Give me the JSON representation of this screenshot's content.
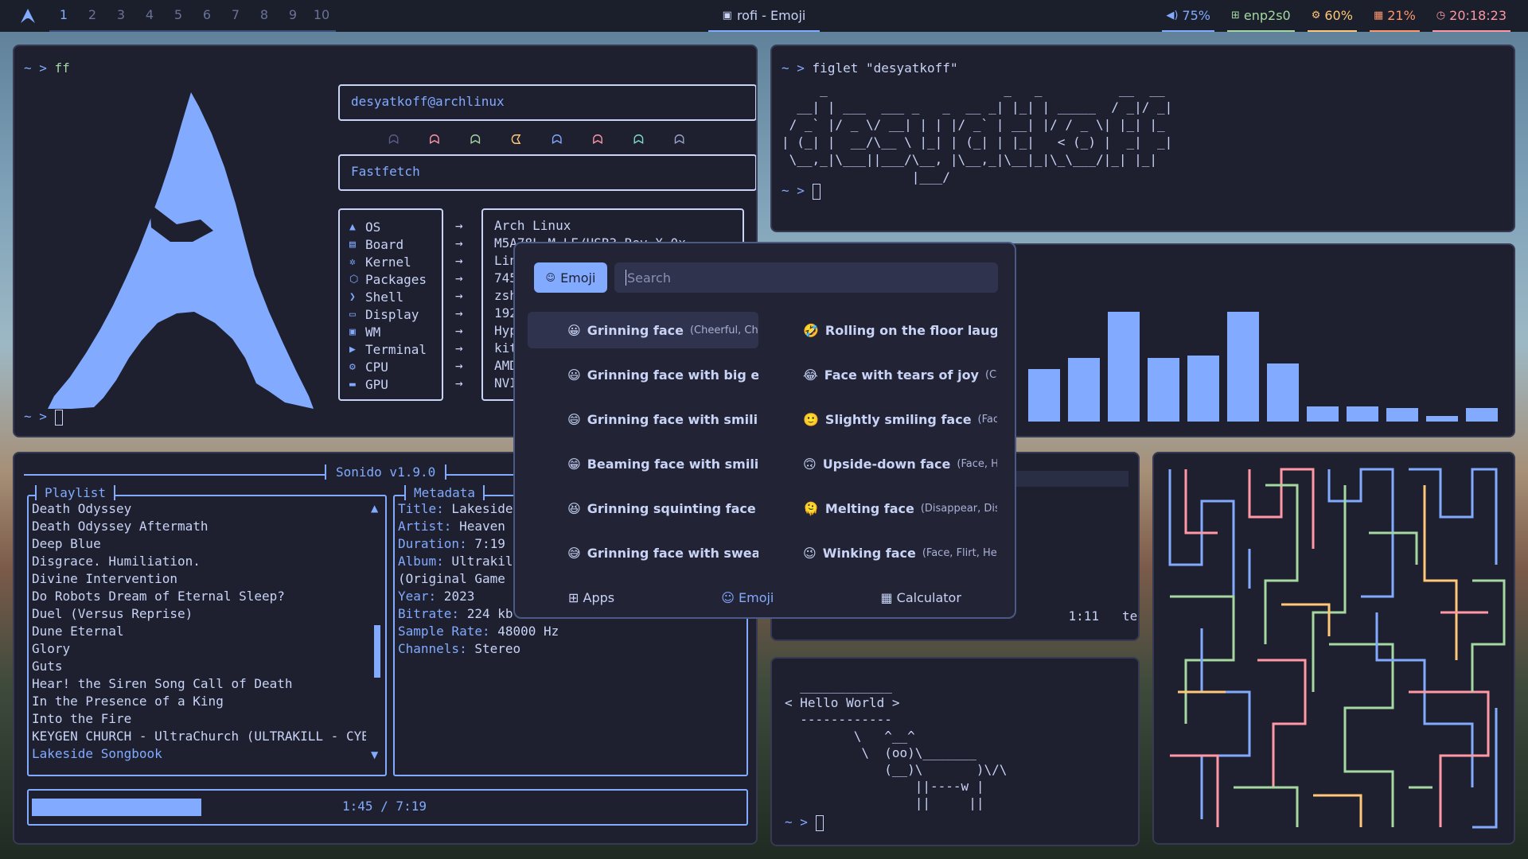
{
  "topbar": {
    "workspaces": [
      "1",
      "2",
      "3",
      "4",
      "5",
      "6",
      "7",
      "8",
      "9",
      "10"
    ],
    "active_workspace": "1",
    "window_title": "rofi - Emoji",
    "volume": "75%",
    "network": "enp2s0",
    "cpu": "60%",
    "memory": "21%",
    "clock": "20:18:23"
  },
  "fastfetch_term": {
    "prompt": "~ >",
    "command": "ff",
    "user_host": "desyatkoff@archlinux",
    "title": "Fastfetch",
    "keys": [
      "OS",
      "Board",
      "Kernel",
      "Packages",
      "Shell",
      "Display",
      "WM",
      "Terminal",
      "CPU",
      "GPU"
    ],
    "values": [
      "Arch Linux",
      "M5A78L-M LE/USB3 Rev X.0x",
      "Lin",
      "745",
      "zsh",
      "192",
      "Hyp",
      "kit",
      "AMD",
      "NVI"
    ],
    "ghost_colors": [
      "#565f89",
      "#ff98a4",
      "#a5d8a0",
      "#ffc777",
      "#82aaff",
      "#ff98a4",
      "#7fdbca",
      "#9aa5ce"
    ]
  },
  "figlet_term": {
    "prompt": "~ >",
    "command": "figlet \"desyatkoff\"",
    "art": "     _                       _   _          __  __ \n  __| | ___  ___ _   _  __ _| |_| | _____  / _|/ _|\n / _` |/ _ \\/ __| | | |/ _` | __| |/ / _ \\| |_| |_ \n| (_| |  __/\\__ \\ |_| | (_| | |_|   < (_) |  _|  _|\n \\__,_|\\___||___/\\__, |\\__,_|\\__|_|\\_\\___/|_| |_|  \n                 |___/                             "
  },
  "sonido": {
    "title": "Sonido v1.9.0",
    "playlist_label": "Playlist",
    "metadata_label": "Metadata",
    "playlist": [
      "Death Odyssey",
      "Death Odyssey Aftermath",
      "Deep Blue",
      "Disgrace. Humiliation.",
      "Divine Intervention",
      "Do Robots Dream of Eternal Sleep?",
      "Duel (Versus Reprise)",
      "Dune Eternal",
      "Glory",
      "Guts",
      "Hear! the Siren Song Call of Death",
      "In the Presence of a King",
      "Into the Fire",
      "KEYGEN CHURCH - UltraChurch (ULTRAKILL - CYB",
      "Lakeside Songbook"
    ],
    "metadata": [
      {
        "k": "Title:",
        "v": "Lakeside"
      },
      {
        "k": "Artist:",
        "v": "Heaven"
      },
      {
        "k": "Duration:",
        "v": "7:19"
      },
      {
        "k": "Album:",
        "v": "Ultrakil"
      },
      {
        "k": "",
        "v": "(Original Game"
      },
      {
        "k": "Year:",
        "v": "2023"
      },
      {
        "k": "Bitrate:",
        "v": "224 kb"
      },
      {
        "k": "Sample Rate:",
        "v": "48000 Hz"
      },
      {
        "k": "Channels:",
        "v": "Stereo"
      }
    ],
    "progress_text": "1:45 / 7:19",
    "progress_fraction": 0.239
  },
  "editor_partial": {
    "position": "1:11",
    "filetype": "text"
  },
  "cowsay_term": {
    "prompt": "~ >",
    "art": "  ____________\n< Hello World >\n  ------------\n         \\   ^__^\n          \\  (oo)\\_______\n             (__)\\       )\\/\\\n                 ||----w |\n                 ||     ||"
  },
  "cava": {
    "levels": [
      0.48,
      0.58,
      1.0,
      0.58,
      0.6,
      1.0,
      0.53,
      0.14,
      0.14,
      0.12,
      0.05,
      0.12
    ]
  },
  "rofi": {
    "active_mode": "Emoji",
    "search_placeholder": "Search",
    "items": [
      {
        "emoji": "😀",
        "name": "Grinning face",
        "kw": "(Cheerful, Che..."
      },
      {
        "emoji": "🤣",
        "name": "Rolling on the floor laug...",
        "kw": ""
      },
      {
        "emoji": "😃",
        "name": "Grinning face with big ey...",
        "kw": ""
      },
      {
        "emoji": "😂",
        "name": "Face with tears of joy",
        "kw": "(Cry..."
      },
      {
        "emoji": "😄",
        "name": "Grinning face with smili...",
        "kw": ""
      },
      {
        "emoji": "🙂",
        "name": "Slightly smiling face",
        "kw": "(Face,..."
      },
      {
        "emoji": "😁",
        "name": "Beaming face with smili...",
        "kw": ""
      },
      {
        "emoji": "🙃",
        "name": "Upside-down face",
        "kw": "(Face, H..."
      },
      {
        "emoji": "😆",
        "name": "Grinning squinting face",
        "kw": "(..."
      },
      {
        "emoji": "🫠",
        "name": "Melting face",
        "kw": "(Disappear, Diss..."
      },
      {
        "emoji": "😅",
        "name": "Grinning face with swea...",
        "kw": ""
      },
      {
        "emoji": "😉",
        "name": "Winking face",
        "kw": "(Face, Flirt, He..."
      }
    ],
    "modes": [
      "Apps",
      "Emoji",
      "Calculator"
    ]
  },
  "colors": {
    "accent": "#82aaff",
    "window_bg": "#1e2030",
    "bar_bg": "#1b1e2b"
  }
}
